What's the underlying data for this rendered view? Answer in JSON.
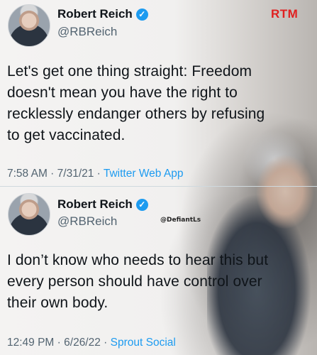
{
  "watermark_brand": "RTM",
  "watermark_credit": "@DefiantLs",
  "colors": {
    "verified": "#1d9bf0",
    "link": "#1d9bf0",
    "brand_red": "#e02020"
  },
  "tweets": [
    {
      "name": "Robert Reich",
      "handle": "@RBReich",
      "text_lines": [
        "Let's get one thing straight: Freedom",
        "doesn't mean you have the right to",
        "recklessly endanger others by refusing",
        "to get vaccinated."
      ],
      "time": "7:58 AM",
      "date": "7/31/21",
      "source": "Twitter Web App"
    },
    {
      "name": "Robert Reich",
      "handle": "@RBReich",
      "text_lines": [
        "I don’t know who needs to hear this but",
        "every person should have control over",
        "their own body."
      ],
      "time": "12:49 PM",
      "date": "6/26/22",
      "source": "Sprout Social"
    }
  ],
  "icons": [
    "verified-badge-icon",
    "avatar"
  ]
}
